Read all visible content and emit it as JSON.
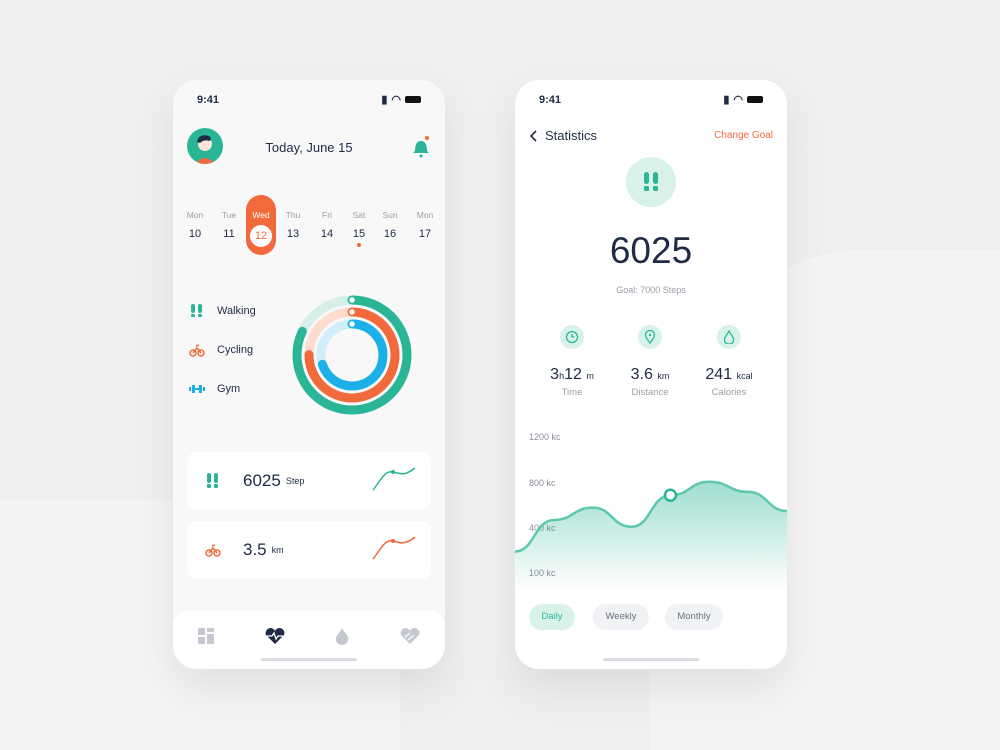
{
  "colors": {
    "accent": "#f26a3c",
    "green": "#2bb597",
    "blue": "#1cb0e8",
    "navy": "#1f2a44"
  },
  "left": {
    "status_time": "9:41",
    "header_title": "Today, June 15",
    "days": [
      {
        "name": "Mon",
        "num": "10"
      },
      {
        "name": "Tue",
        "num": "11"
      },
      {
        "name": "Wed",
        "num": "12",
        "selected": true
      },
      {
        "name": "Thu",
        "num": "13"
      },
      {
        "name": "Fri",
        "num": "14"
      },
      {
        "name": "Sat",
        "num": "15",
        "dot": true
      },
      {
        "name": "Sun",
        "num": "16"
      },
      {
        "name": "Mon",
        "num": "17"
      }
    ],
    "legend": [
      {
        "label": "Walking",
        "icon": "footsteps-icon"
      },
      {
        "label": "Cycling",
        "icon": "bicycle-icon"
      },
      {
        "label": "Gym",
        "icon": "dumbbell-icon"
      }
    ],
    "rings": [
      {
        "activity": "Walking",
        "progress": 0.82
      },
      {
        "activity": "Cycling",
        "progress": 0.75
      },
      {
        "activity": "Gym",
        "progress": 0.7
      }
    ],
    "cards": [
      {
        "value": "6025",
        "unit": "Step",
        "icon": "footsteps-icon"
      },
      {
        "value": "3.5",
        "unit": "km",
        "icon": "bicycle-icon"
      }
    ],
    "nav": [
      "dashboard-icon",
      "heart-pulse-icon",
      "flame-icon",
      "heart-hands-icon"
    ],
    "nav_active": 1
  },
  "right": {
    "status_time": "9:41",
    "title": "Statistics",
    "change_goal": "Change Goal",
    "steps": "6025",
    "goal": "Goal: 7000 Steps",
    "stats": [
      {
        "value": "3",
        "unit1": "h",
        "value2": "12",
        "unit2": "m",
        "label": "Time",
        "icon": "clock-icon"
      },
      {
        "value": "3.6",
        "unit1": "km",
        "label": "Distance",
        "icon": "location-pin-icon"
      },
      {
        "value": "241",
        "unit1": "kcal",
        "label": "Calories",
        "icon": "flame-icon"
      }
    ],
    "periods": [
      "Daily",
      "Weekly",
      "Monthly"
    ],
    "active_period": "Daily"
  },
  "chart_data": {
    "type": "area",
    "y_ticks": [
      "1200 kc",
      "800 kc",
      "400 kc",
      "100 kc"
    ],
    "y_tick_values": [
      1200,
      800,
      400,
      100
    ],
    "values": [
      250,
      480,
      590,
      420,
      700,
      820,
      730,
      560
    ],
    "highlight_index": 4,
    "grid": false
  }
}
